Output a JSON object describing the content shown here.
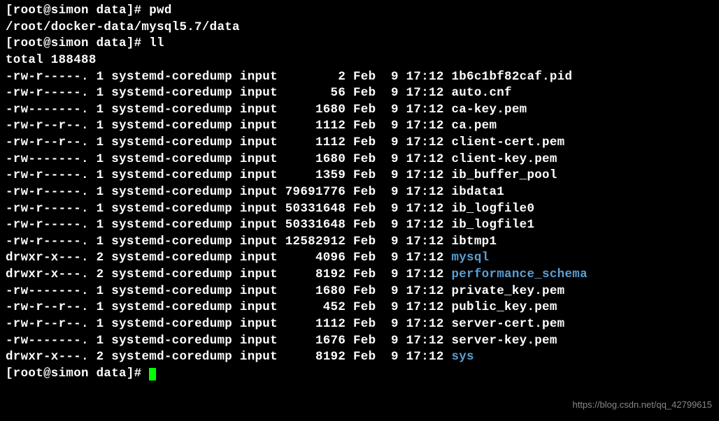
{
  "prompt1": "[root@simon data]# ",
  "cmd1": "pwd",
  "pwd_out": "/root/docker-data/mysql5.7/data",
  "prompt2": "[root@simon data]# ",
  "cmd2": "ll",
  "total_line": "total 188488",
  "rows": [
    {
      "perm": "-rw-r-----.",
      "links": "1",
      "owner": "systemd-coredump",
      "group": "input",
      "size": "       2",
      "month": "Feb",
      "day": " 9",
      "time": "17:12",
      "name": "1b6c1bf82caf.pid",
      "isdir": false
    },
    {
      "perm": "-rw-r-----.",
      "links": "1",
      "owner": "systemd-coredump",
      "group": "input",
      "size": "      56",
      "month": "Feb",
      "day": " 9",
      "time": "17:12",
      "name": "auto.cnf",
      "isdir": false
    },
    {
      "perm": "-rw-------.",
      "links": "1",
      "owner": "systemd-coredump",
      "group": "input",
      "size": "    1680",
      "month": "Feb",
      "day": " 9",
      "time": "17:12",
      "name": "ca-key.pem",
      "isdir": false
    },
    {
      "perm": "-rw-r--r--.",
      "links": "1",
      "owner": "systemd-coredump",
      "group": "input",
      "size": "    1112",
      "month": "Feb",
      "day": " 9",
      "time": "17:12",
      "name": "ca.pem",
      "isdir": false
    },
    {
      "perm": "-rw-r--r--.",
      "links": "1",
      "owner": "systemd-coredump",
      "group": "input",
      "size": "    1112",
      "month": "Feb",
      "day": " 9",
      "time": "17:12",
      "name": "client-cert.pem",
      "isdir": false
    },
    {
      "perm": "-rw-------.",
      "links": "1",
      "owner": "systemd-coredump",
      "group": "input",
      "size": "    1680",
      "month": "Feb",
      "day": " 9",
      "time": "17:12",
      "name": "client-key.pem",
      "isdir": false
    },
    {
      "perm": "-rw-r-----.",
      "links": "1",
      "owner": "systemd-coredump",
      "group": "input",
      "size": "    1359",
      "month": "Feb",
      "day": " 9",
      "time": "17:12",
      "name": "ib_buffer_pool",
      "isdir": false
    },
    {
      "perm": "-rw-r-----.",
      "links": "1",
      "owner": "systemd-coredump",
      "group": "input",
      "size": "79691776",
      "month": "Feb",
      "day": " 9",
      "time": "17:12",
      "name": "ibdata1",
      "isdir": false
    },
    {
      "perm": "-rw-r-----.",
      "links": "1",
      "owner": "systemd-coredump",
      "group": "input",
      "size": "50331648",
      "month": "Feb",
      "day": " 9",
      "time": "17:12",
      "name": "ib_logfile0",
      "isdir": false
    },
    {
      "perm": "-rw-r-----.",
      "links": "1",
      "owner": "systemd-coredump",
      "group": "input",
      "size": "50331648",
      "month": "Feb",
      "day": " 9",
      "time": "17:12",
      "name": "ib_logfile1",
      "isdir": false
    },
    {
      "perm": "-rw-r-----.",
      "links": "1",
      "owner": "systemd-coredump",
      "group": "input",
      "size": "12582912",
      "month": "Feb",
      "day": " 9",
      "time": "17:12",
      "name": "ibtmp1",
      "isdir": false
    },
    {
      "perm": "drwxr-x---.",
      "links": "2",
      "owner": "systemd-coredump",
      "group": "input",
      "size": "    4096",
      "month": "Feb",
      "day": " 9",
      "time": "17:12",
      "name": "mysql",
      "isdir": true
    },
    {
      "perm": "drwxr-x---.",
      "links": "2",
      "owner": "systemd-coredump",
      "group": "input",
      "size": "    8192",
      "month": "Feb",
      "day": " 9",
      "time": "17:12",
      "name": "performance_schema",
      "isdir": true
    },
    {
      "perm": "-rw-------.",
      "links": "1",
      "owner": "systemd-coredump",
      "group": "input",
      "size": "    1680",
      "month": "Feb",
      "day": " 9",
      "time": "17:12",
      "name": "private_key.pem",
      "isdir": false
    },
    {
      "perm": "-rw-r--r--.",
      "links": "1",
      "owner": "systemd-coredump",
      "group": "input",
      "size": "     452",
      "month": "Feb",
      "day": " 9",
      "time": "17:12",
      "name": "public_key.pem",
      "isdir": false
    },
    {
      "perm": "-rw-r--r--.",
      "links": "1",
      "owner": "systemd-coredump",
      "group": "input",
      "size": "    1112",
      "month": "Feb",
      "day": " 9",
      "time": "17:12",
      "name": "server-cert.pem",
      "isdir": false
    },
    {
      "perm": "-rw-------.",
      "links": "1",
      "owner": "systemd-coredump",
      "group": "input",
      "size": "    1676",
      "month": "Feb",
      "day": " 9",
      "time": "17:12",
      "name": "server-key.pem",
      "isdir": false
    },
    {
      "perm": "drwxr-x---.",
      "links": "2",
      "owner": "systemd-coredump",
      "group": "input",
      "size": "    8192",
      "month": "Feb",
      "day": " 9",
      "time": "17:12",
      "name": "sys",
      "isdir": true
    }
  ],
  "prompt3": "[root@simon data]# ",
  "watermark": "https://blog.csdn.net/qq_42799615"
}
